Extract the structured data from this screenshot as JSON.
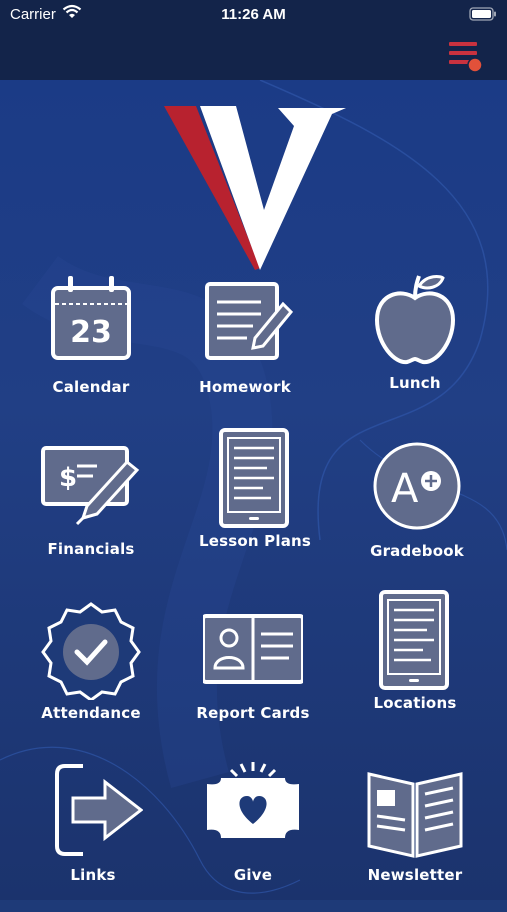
{
  "status_bar": {
    "carrier": "Carrier",
    "time": "11:26 AM"
  },
  "nav": {
    "menu_icon": "hamburger-menu-icon",
    "notification_dot_color": "#e2513a"
  },
  "brand": {
    "logo_icon": "v-logo-icon",
    "accent_red": "#b8222f",
    "primary_blue": "#1e3a78",
    "tile_fill": "#606b8c"
  },
  "tiles": [
    {
      "label": "Calendar",
      "icon": "calendar-icon",
      "day": "23"
    },
    {
      "label": "Homework",
      "icon": "homework-icon"
    },
    {
      "label": "Lunch",
      "icon": "apple-icon"
    },
    {
      "label": "Financials",
      "icon": "check-icon"
    },
    {
      "label": "Lesson Plans",
      "icon": "tablet-icon"
    },
    {
      "label": "Gradebook",
      "icon": "grade-icon",
      "grade": "A"
    },
    {
      "label": "Attendance",
      "icon": "badge-check-icon"
    },
    {
      "label": "Report Cards",
      "icon": "report-card-icon"
    },
    {
      "label": "Locations",
      "icon": "tablet-list-icon"
    },
    {
      "label": "Links",
      "icon": "link-arrow-icon"
    },
    {
      "label": "Give",
      "icon": "give-heart-icon"
    },
    {
      "label": "Newsletter",
      "icon": "newsletter-icon"
    }
  ]
}
